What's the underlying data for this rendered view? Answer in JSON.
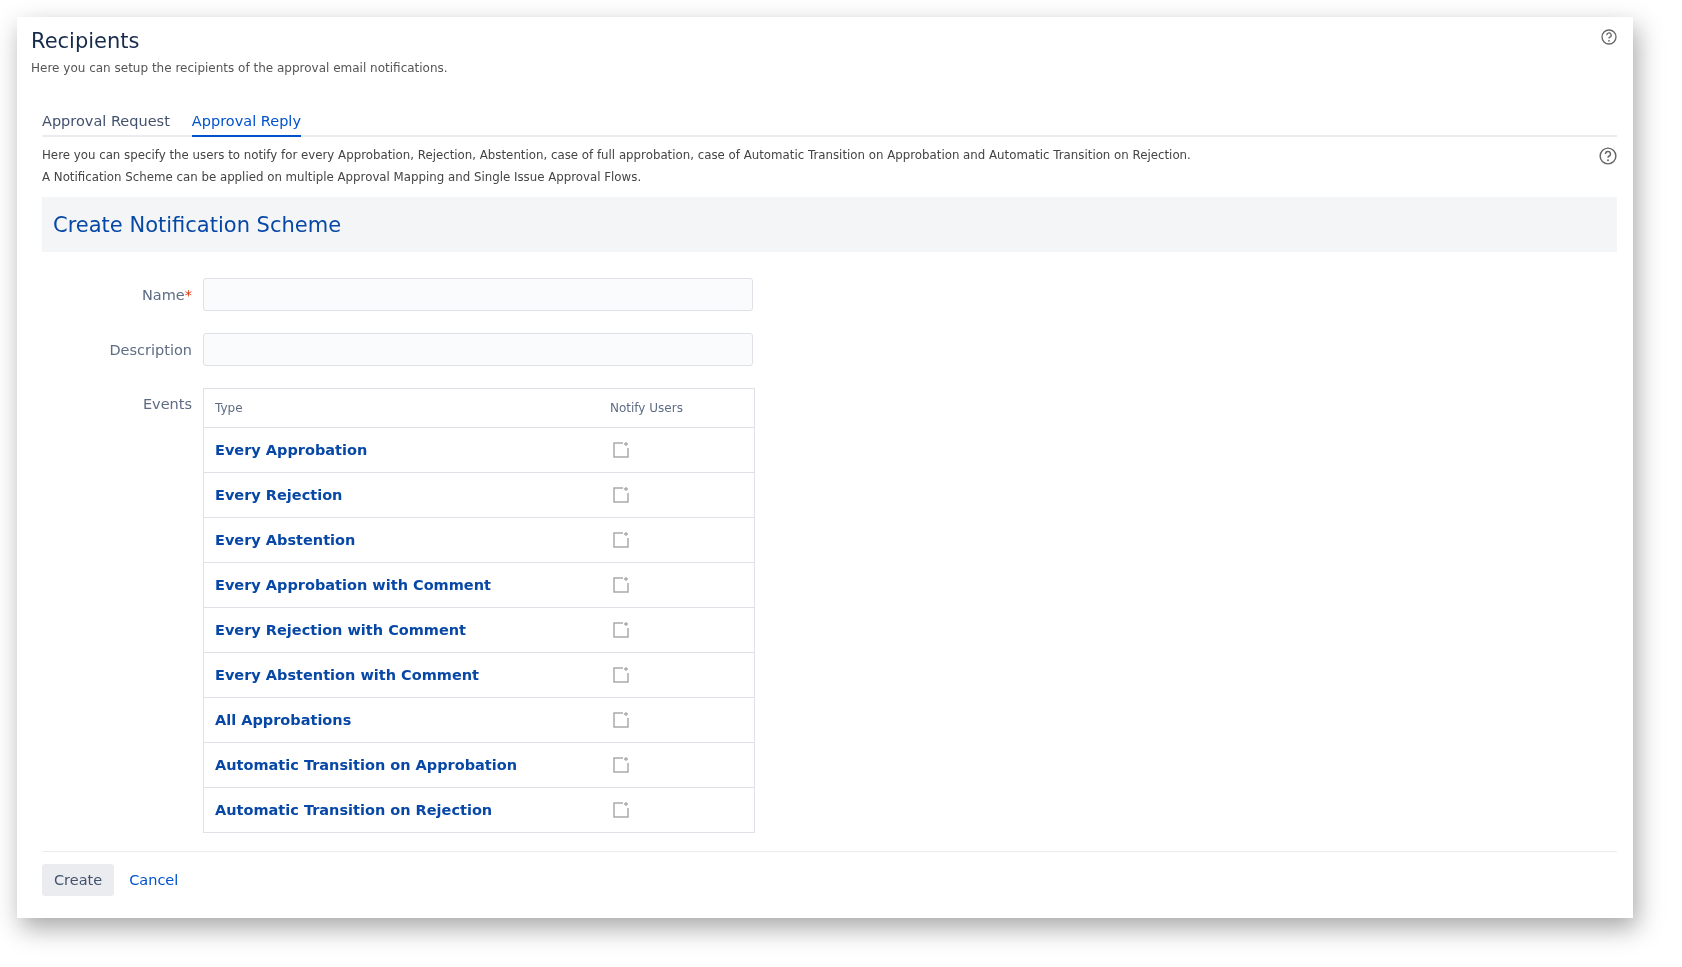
{
  "page": {
    "title": "Recipients",
    "subtitle": "Here you can setup the recipients of the approval email notifications."
  },
  "tabs": [
    {
      "label": "Approval Request",
      "selected": false
    },
    {
      "label": "Approval Reply",
      "selected": true
    }
  ],
  "description": [
    "Here you can specify the users to notify for every Approbation, Rejection, Abstention, case of full approbation, case of Automatic Transition on Approbation and Automatic Transition on Rejection.",
    "A Notification Scheme can be applied on multiple Approval Mapping and Single Issue Approval Flows."
  ],
  "form": {
    "title": "Create Notification Scheme",
    "fields": [
      {
        "label": "Name",
        "required_mark": "*"
      },
      {
        "label": "Description"
      }
    ],
    "events_label": "Events",
    "events_table": {
      "columns": [
        "Type",
        "Notify Users"
      ],
      "rows": [
        {
          "type": "Every Approbation"
        },
        {
          "type": "Every Rejection"
        },
        {
          "type": "Every Abstention"
        },
        {
          "type": "Every Approbation with Comment"
        },
        {
          "type": "Every Rejection with Comment"
        },
        {
          "type": "Every Abstention with Comment"
        },
        {
          "type": "All Approbations"
        },
        {
          "type": "Automatic Transition on Approbation"
        },
        {
          "type": "Automatic Transition on Rejection"
        }
      ]
    }
  },
  "buttons": {
    "primary": "Create",
    "link": "Cancel"
  }
}
